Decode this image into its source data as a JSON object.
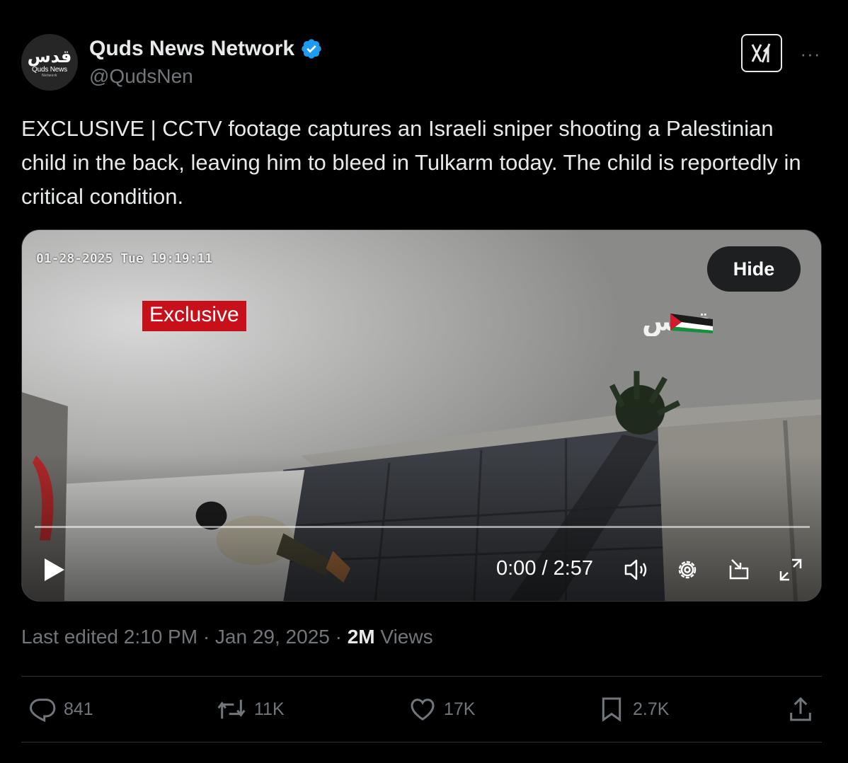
{
  "author": {
    "name": "Quds News Network",
    "handle": "@QudsNen",
    "avatar_text_ar": "قدس",
    "avatar_text_en": "Quds News",
    "avatar_sub": "Network",
    "verified_color": "#1d9bf0"
  },
  "tweet": {
    "text": "EXCLUSIVE | CCTV footage captures an Israeli sniper shooting a Palestinian child in the back, leaving him to bleed in Tulkarm today. The child is reportedly in critical condition."
  },
  "video": {
    "camera_timestamp": "01-28-2025 Tue 19:19:11",
    "overlay_label": "Exclusive",
    "hide_label": "Hide",
    "watermark_text": "قدس",
    "time_display": "0:00 / 2:57",
    "progress": 0,
    "label_color": "#c8101b"
  },
  "meta": {
    "edited": "Last edited 2:10 PM · Jan 29, 2025 · ",
    "views_count": "2M",
    "views_label": " Views"
  },
  "actions": {
    "replies": "841",
    "reposts": "11K",
    "likes": "17K",
    "bookmarks": "2.7K"
  },
  "icons": [
    "grok-icon",
    "more-icon",
    "verified-icon",
    "play-icon",
    "volume-icon",
    "settings-icon",
    "minimize-icon",
    "fullscreen-icon",
    "reply-icon",
    "repost-icon",
    "like-icon",
    "bookmark-icon",
    "share-icon"
  ]
}
